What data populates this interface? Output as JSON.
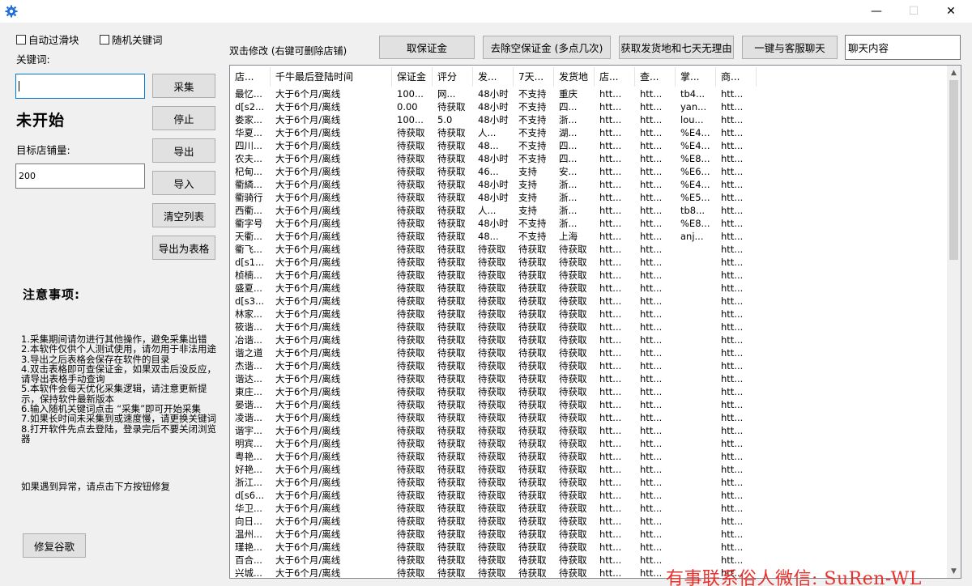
{
  "window": {
    "minimize_glyph": "—",
    "maximize_glyph": "☐",
    "close_glyph": "✕"
  },
  "left": {
    "auto_slider_label": "自动过滑块",
    "random_keyword_label": "随机关键词",
    "keyword_label": "关键词:",
    "keyword_value": "",
    "collect_button": "采集",
    "stop_button": "停止",
    "status_text": "未开始",
    "target_label": "目标店铺量:",
    "target_value": "200",
    "export_button": "导出",
    "import_button": "导入",
    "clear_button": "清空列表",
    "export_table_button": "导出为表格",
    "notes_title": "注意事项:",
    "notes": [
      "1.采集期间请勿进行其他操作，避免采集出错",
      "2.本软件仅供个人测试使用，请勿用于非法用途",
      "3.导出之后表格会保存在软件的目录",
      "4.双击表格即可查保证金，如果双击后没反应，请导出表格手动查询",
      "5.本软件会每天优化采集逻辑，请注意更新提示，保持软件最新版本",
      "6.输入随机关键词点击 “采集”即可开始采集",
      "7.如果长时间未采集到或速度慢，请更换关键词",
      "8.打开软件先点去登陆，登录完后不要关闭浏览器"
    ],
    "note_extra": "如果遇到异常，请点击下方按钮修复",
    "repair_button": "修复谷歌"
  },
  "toolbar": {
    "hint": "双击修改 (右键可删除店铺)",
    "get_deposit": "取保证金",
    "remove_empty": "去除空保证金 (多点几次)",
    "get_origin": "获取发货地和七天无理由",
    "chat_all": "一键与客服聊天",
    "chat_content": "聊天内容"
  },
  "table": {
    "columns": [
      "店...",
      "千牛最后登陆时间",
      "保证金",
      "评分",
      "发...",
      "7天...",
      "发货地",
      "店...",
      "查...",
      "掌...",
      "商..."
    ],
    "rows": [
      [
        "最忆...",
        "大于6个月/离线",
        "100...",
        "网...",
        "48小时",
        "不支持",
        "重庆",
        "htt...",
        "htt...",
        "tb4...",
        "htt..."
      ],
      [
        "d[s2...",
        "大于6个月/离线",
        "0.00",
        "待获取",
        "48小时",
        "不支持",
        "四...",
        "htt...",
        "htt...",
        "yan...",
        "htt..."
      ],
      [
        "娄家...",
        "大于6个月/离线",
        "100...",
        "5.0",
        "48小时",
        "不支持",
        "浙...",
        "htt...",
        "htt...",
        "lou...",
        "htt..."
      ],
      [
        "华夏...",
        "大于6个月/离线",
        "待获取",
        "待获取",
        "人...",
        "不支持",
        "湖...",
        "htt...",
        "htt...",
        "%E4...",
        "htt..."
      ],
      [
        "四川...",
        "大于6个月/离线",
        "待获取",
        "待获取",
        "48...",
        "不支持",
        "四...",
        "htt...",
        "htt...",
        "%E4...",
        "htt..."
      ],
      [
        "农夫...",
        "大于6个月/离线",
        "待获取",
        "待获取",
        "48小时",
        "不支持",
        "四...",
        "htt...",
        "htt...",
        "%E8...",
        "htt..."
      ],
      [
        "杞甸...",
        "大于6个月/离线",
        "待获取",
        "待获取",
        "46...",
        "支持",
        "安...",
        "htt...",
        "htt...",
        "%E6...",
        "htt..."
      ],
      [
        "衢繗...",
        "大于6个月/离线",
        "待获取",
        "待获取",
        "48小时",
        "支持",
        "浙...",
        "htt...",
        "htt...",
        "%E4...",
        "htt..."
      ],
      [
        "衢骑行",
        "大于6个月/离线",
        "待获取",
        "待获取",
        "48小时",
        "支持",
        "浙...",
        "htt...",
        "htt...",
        "%E5...",
        "htt..."
      ],
      [
        "西衢...",
        "大于6个月/离线",
        "待获取",
        "待获取",
        "人...",
        "支持",
        "浙...",
        "htt...",
        "htt...",
        "tb8...",
        "htt..."
      ],
      [
        "衢字号",
        "大于6个月/离线",
        "待获取",
        "待获取",
        "48小时",
        "不支持",
        "浙...",
        "htt...",
        "htt...",
        "%E8...",
        "htt..."
      ],
      [
        "天衢...",
        "大于6个月/离线",
        "待获取",
        "待获取",
        "48...",
        "不支持",
        "上海",
        "htt...",
        "htt...",
        "anj...",
        "htt..."
      ],
      [
        "衢飞...",
        "大于6个月/离线",
        "待获取",
        "待获取",
        "待获取",
        "待获取",
        "待获取",
        "htt...",
        "htt...",
        "",
        "htt..."
      ],
      [
        "d[s1...",
        "大于6个月/离线",
        "待获取",
        "待获取",
        "待获取",
        "待获取",
        "待获取",
        "htt...",
        "htt...",
        "",
        "htt..."
      ],
      [
        "桢楠...",
        "大于6个月/离线",
        "待获取",
        "待获取",
        "待获取",
        "待获取",
        "待获取",
        "htt...",
        "htt...",
        "",
        "htt..."
      ],
      [
        "盛夏...",
        "大于6个月/离线",
        "待获取",
        "待获取",
        "待获取",
        "待获取",
        "待获取",
        "htt...",
        "htt...",
        "",
        "htt..."
      ],
      [
        "d[s3...",
        "大于6个月/离线",
        "待获取",
        "待获取",
        "待获取",
        "待获取",
        "待获取",
        "htt...",
        "htt...",
        "",
        "htt..."
      ],
      [
        "林家...",
        "大于6个月/离线",
        "待获取",
        "待获取",
        "待获取",
        "待获取",
        "待获取",
        "htt...",
        "htt...",
        "",
        "htt..."
      ],
      [
        "筱谐...",
        "大于6个月/离线",
        "待获取",
        "待获取",
        "待获取",
        "待获取",
        "待获取",
        "htt...",
        "htt...",
        "",
        "htt..."
      ],
      [
        "冶谐...",
        "大于6个月/离线",
        "待获取",
        "待获取",
        "待获取",
        "待获取",
        "待获取",
        "htt...",
        "htt...",
        "",
        "htt..."
      ],
      [
        "谐之道",
        "大于6个月/离线",
        "待获取",
        "待获取",
        "待获取",
        "待获取",
        "待获取",
        "htt...",
        "htt...",
        "",
        "htt..."
      ],
      [
        "杰谐...",
        "大于6个月/离线",
        "待获取",
        "待获取",
        "待获取",
        "待获取",
        "待获取",
        "htt...",
        "htt...",
        "",
        "htt..."
      ],
      [
        "谐达...",
        "大于6个月/离线",
        "待获取",
        "待获取",
        "待获取",
        "待获取",
        "待获取",
        "htt...",
        "htt...",
        "",
        "htt..."
      ],
      [
        "東庄...",
        "大于6个月/离线",
        "待获取",
        "待获取",
        "待获取",
        "待获取",
        "待获取",
        "htt...",
        "htt...",
        "",
        "htt..."
      ],
      [
        "晏谐...",
        "大于6个月/离线",
        "待获取",
        "待获取",
        "待获取",
        "待获取",
        "待获取",
        "htt...",
        "htt...",
        "",
        "htt..."
      ],
      [
        "凌谐...",
        "大于6个月/离线",
        "待获取",
        "待获取",
        "待获取",
        "待获取",
        "待获取",
        "htt...",
        "htt...",
        "",
        "htt..."
      ],
      [
        "谐宇...",
        "大于6个月/离线",
        "待获取",
        "待获取",
        "待获取",
        "待获取",
        "待获取",
        "htt...",
        "htt...",
        "",
        "htt..."
      ],
      [
        "明宾...",
        "大于6个月/离线",
        "待获取",
        "待获取",
        "待获取",
        "待获取",
        "待获取",
        "htt...",
        "htt...",
        "",
        "htt..."
      ],
      [
        "粤艳...",
        "大于6个月/离线",
        "待获取",
        "待获取",
        "待获取",
        "待获取",
        "待获取",
        "htt...",
        "htt...",
        "",
        "htt..."
      ],
      [
        "好艳...",
        "大于6个月/离线",
        "待获取",
        "待获取",
        "待获取",
        "待获取",
        "待获取",
        "htt...",
        "htt...",
        "",
        "htt..."
      ],
      [
        "浙江...",
        "大于6个月/离线",
        "待获取",
        "待获取",
        "待获取",
        "待获取",
        "待获取",
        "htt...",
        "htt...",
        "",
        "htt..."
      ],
      [
        "d[s6...",
        "大于6个月/离线",
        "待获取",
        "待获取",
        "待获取",
        "待获取",
        "待获取",
        "htt...",
        "htt...",
        "",
        "htt..."
      ],
      [
        "华卫...",
        "大于6个月/离线",
        "待获取",
        "待获取",
        "待获取",
        "待获取",
        "待获取",
        "htt...",
        "htt...",
        "",
        "htt..."
      ],
      [
        "向日...",
        "大于6个月/离线",
        "待获取",
        "待获取",
        "待获取",
        "待获取",
        "待获取",
        "htt...",
        "htt...",
        "",
        "htt..."
      ],
      [
        "温州...",
        "大于6个月/离线",
        "待获取",
        "待获取",
        "待获取",
        "待获取",
        "待获取",
        "htt...",
        "htt...",
        "",
        "htt..."
      ],
      [
        "瑾艳...",
        "大于6个月/离线",
        "待获取",
        "待获取",
        "待获取",
        "待获取",
        "待获取",
        "htt...",
        "htt...",
        "",
        "htt..."
      ],
      [
        "百合...",
        "大于6个月/离线",
        "待获取",
        "待获取",
        "待获取",
        "待获取",
        "待获取",
        "htt...",
        "htt...",
        "",
        "htt..."
      ],
      [
        "兴城...",
        "大于6个月/离线",
        "待获取",
        "待获取",
        "待获取",
        "待获取",
        "待获取",
        "htt...",
        "htt...",
        "",
        "htt..."
      ]
    ]
  },
  "watermark": "有事联系俗人微信: SuRen-WL",
  "colors": {
    "accent": "#0078d7",
    "watermark": "#e8312c",
    "app_icon": "#1e6fd9"
  }
}
